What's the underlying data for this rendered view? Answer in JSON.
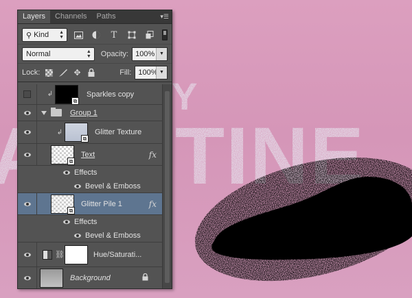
{
  "canvas": {
    "bg_color": "#d89cbc",
    "text_fragments": [
      "Y",
      "A",
      "TINE"
    ],
    "text_color": "#e6e8f0",
    "blob_color": "#000000"
  },
  "panel": {
    "tabs": [
      {
        "label": "Layers",
        "active": true
      },
      {
        "label": "Channels",
        "active": false
      },
      {
        "label": "Paths",
        "active": false
      }
    ],
    "menu_icon": "panel-menu-icon",
    "filter": {
      "kind_label": "Kind",
      "icons": [
        "image-filter-icon",
        "adjustment-filter-icon",
        "type-filter-icon",
        "shape-filter-icon",
        "smart-object-filter-icon"
      ]
    },
    "blend_mode": "Normal",
    "opacity_label": "Opacity:",
    "opacity_value": "100%",
    "lock_label": "Lock:",
    "fill_label": "Fill:",
    "fill_value": "100%"
  },
  "layers": [
    {
      "name": "Sparkles copy",
      "visible": false,
      "thumb": "black",
      "clipped": true
    },
    {
      "name": "Group 1",
      "type": "group",
      "visible": true
    },
    {
      "name": "Glitter Texture",
      "visible": true,
      "thumb": "grad",
      "clipped": true
    },
    {
      "name": "Text",
      "visible": true,
      "thumb": "checker",
      "fx": "fx",
      "effects_label": "Effects",
      "effect": "Bevel & Emboss"
    },
    {
      "name": "Glitter Pile 1",
      "visible": true,
      "thumb": "checker",
      "fx": "fx",
      "selected": true,
      "effects_label": "Effects",
      "effect": "Bevel & Emboss"
    },
    {
      "name": "Hue/Saturati...",
      "visible": true,
      "type": "adjustment"
    },
    {
      "name": "Background",
      "visible": true,
      "thumb": "bg",
      "locked": true
    }
  ]
}
